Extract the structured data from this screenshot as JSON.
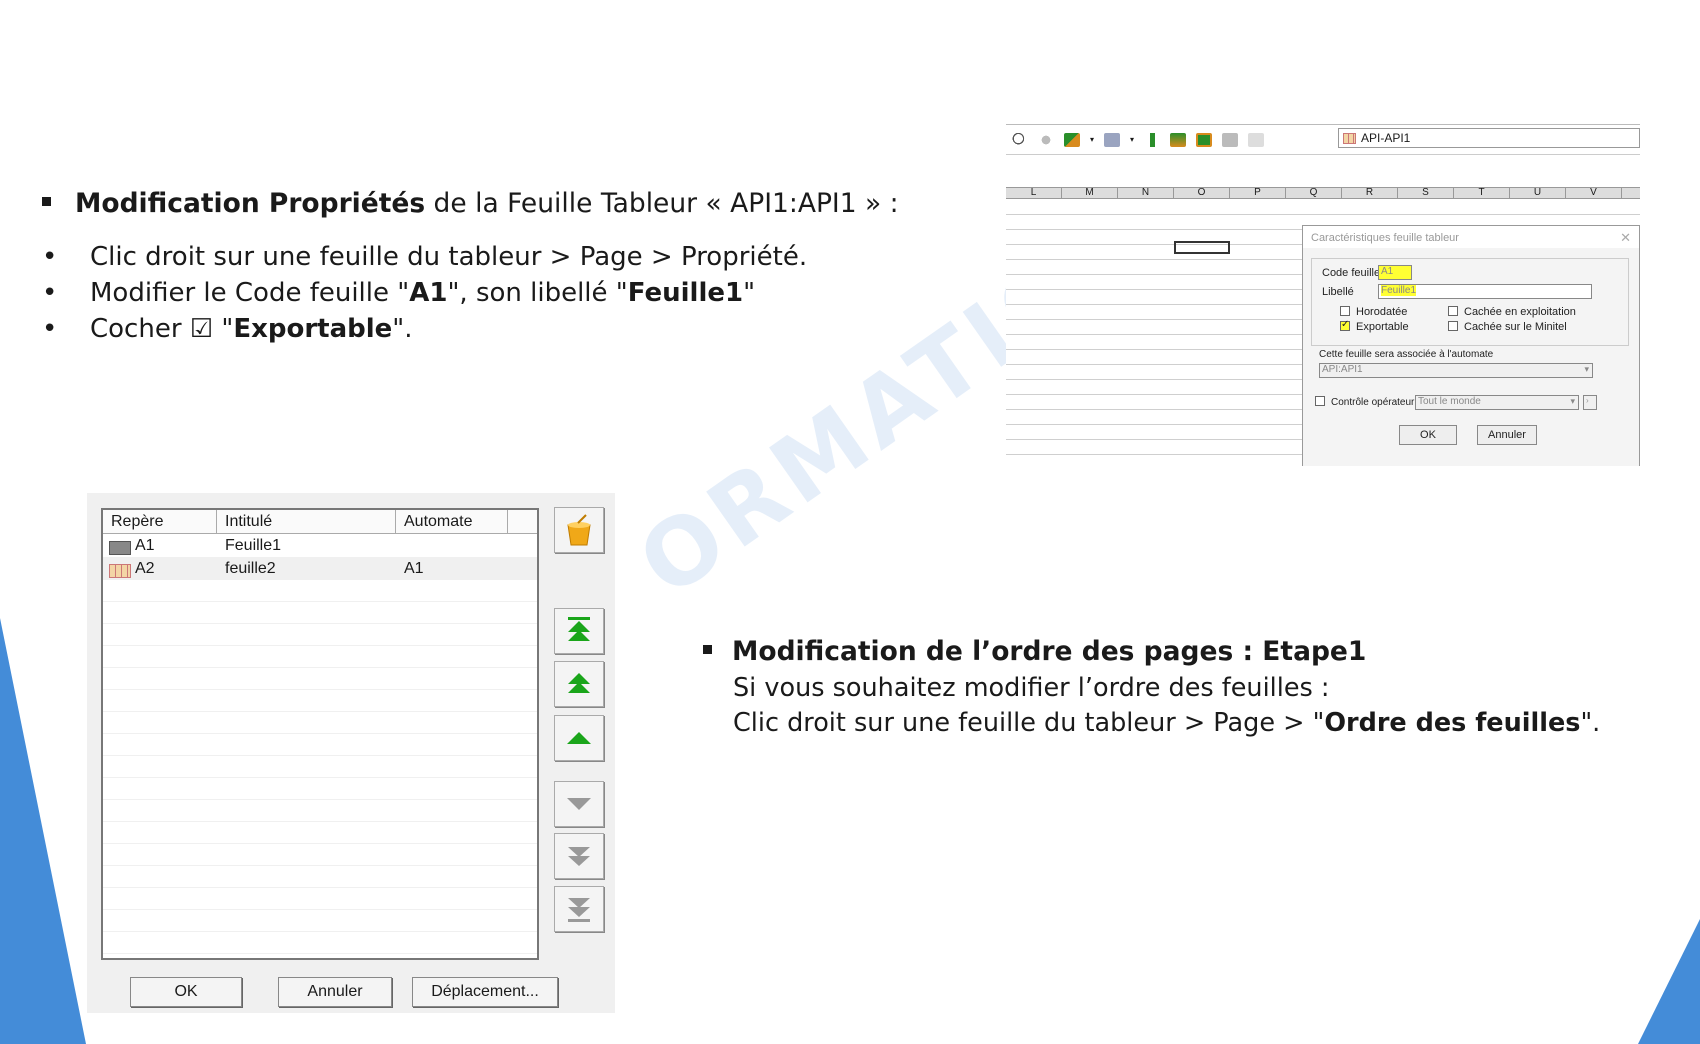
{
  "section1": {
    "title_bold": "Modification Propriétés",
    "title_rest": " de la Feuille Tableur « API1:API1 » :",
    "bullets": [
      {
        "pre": "Clic droit sur une feuille du tableur > Page > Propriété.",
        "bold": "",
        "post": ""
      },
      {
        "pre": "Modifier le Code feuille \"",
        "bold": "A1",
        "mid": "\", son libellé \"",
        "bold2": "Feuille1",
        "post": "\""
      },
      {
        "pre": "Cocher ☑ \"",
        "bold": "Exportable",
        "post": "\"."
      }
    ]
  },
  "section2": {
    "title": "Modification de l’ordre des pages : Etape1",
    "line1": "Si vous souhaitez modifier l’ordre des feuilles :",
    "line2_pre": "Clic droit sur une feuille du tableur > Page > \"",
    "line2_bold": "Ordre des feuilles",
    "line2_post": "\"."
  },
  "watermark": "ORMATION",
  "spreadsheet": {
    "ref_field": "API-API1",
    "columns": [
      "L",
      "M",
      "N",
      "O",
      "P",
      "Q",
      "R",
      "S",
      "T",
      "U",
      "V"
    ]
  },
  "properties_dialog": {
    "title": "Caractéristiques feuille tableur",
    "code_label": "Code feuille",
    "code_value": "A1",
    "libelle_label": "Libellé",
    "libelle_value": "Feuille1",
    "horodatee": "Horodatée",
    "exportable": "Exportable",
    "cachee_exploitation": "Cachée en exploitation",
    "cachee_minitel": "Cachée sur le Minitel",
    "association_label": "Cette feuille sera associée à l'automate",
    "automate_value": "API:API1",
    "controle_label": "Contrôle opérateur",
    "controle_value": "Tout le monde",
    "ok": "OK",
    "cancel": "Annuler"
  },
  "order_dialog": {
    "headers": [
      "Repère",
      "Intitulé",
      "Automate"
    ],
    "rows": [
      {
        "repere": "A1",
        "intitule": "Feuille1",
        "automate": ""
      },
      {
        "repere": "A2",
        "intitule": "feuille2",
        "automate": "A1"
      }
    ],
    "ok": "OK",
    "cancel": "Annuler",
    "move": "Déplacement..."
  },
  "colors": {
    "accent": "#3a86d6",
    "arrow_green": "#1aa51a",
    "highlight": "#ffff33"
  }
}
